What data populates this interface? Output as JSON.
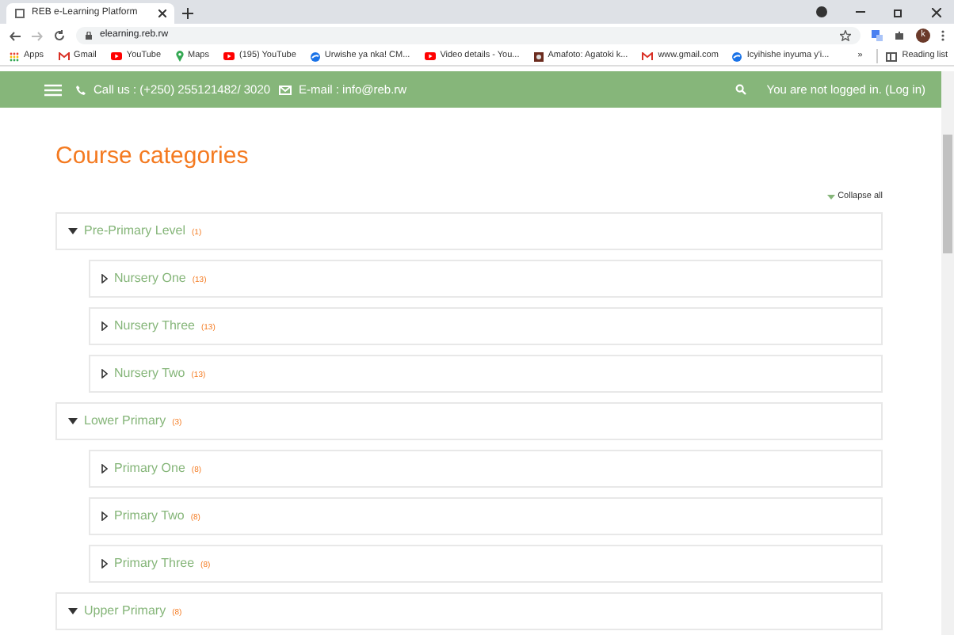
{
  "browser": {
    "tab_title": "REB e-Learning Platform",
    "url": "elearning.reb.rw",
    "profile_initial": "k",
    "bookmarks": [
      {
        "label": "Apps",
        "kind": "apps"
      },
      {
        "label": "Gmail",
        "kind": "gmail"
      },
      {
        "label": "YouTube",
        "kind": "youtube"
      },
      {
        "label": "Maps",
        "kind": "maps"
      },
      {
        "label": "(195) YouTube",
        "kind": "youtube"
      },
      {
        "label": "Urwishe ya nka! CM...",
        "kind": "globe"
      },
      {
        "label": "Video details - You...",
        "kind": "youtube"
      },
      {
        "label": "Amafoto: Agatoki k...",
        "kind": "photo"
      },
      {
        "label": "www.gmail.com",
        "kind": "gmail"
      },
      {
        "label": "Icyihishe inyuma y'i...",
        "kind": "globe"
      }
    ],
    "more": "»",
    "reading_list": "Reading list"
  },
  "navbar": {
    "phone": "Call us : (+250) 255121482/ 3020",
    "email": "E-mail : info@reb.rw",
    "login_text": "You are not logged in. (",
    "login_link": "Log in",
    "login_close": ")"
  },
  "page_title": "Course categories",
  "collapse_all": "Collapse all",
  "categories": [
    {
      "name": "Pre-Primary Level",
      "count": "(1)",
      "expanded": true,
      "children": [
        {
          "name": "Nursery One",
          "count": "(13)",
          "expanded": false
        },
        {
          "name": "Nursery Three",
          "count": "(13)",
          "expanded": false
        },
        {
          "name": "Nursery Two",
          "count": "(13)",
          "expanded": false
        }
      ]
    },
    {
      "name": "Lower Primary",
      "count": "(3)",
      "expanded": true,
      "children": [
        {
          "name": "Primary One",
          "count": "(8)",
          "expanded": false
        },
        {
          "name": "Primary Two",
          "count": "(8)",
          "expanded": false
        },
        {
          "name": "Primary Three",
          "count": "(8)",
          "expanded": false
        }
      ]
    },
    {
      "name": "Upper Primary",
      "count": "(8)",
      "expanded": true
    }
  ]
}
